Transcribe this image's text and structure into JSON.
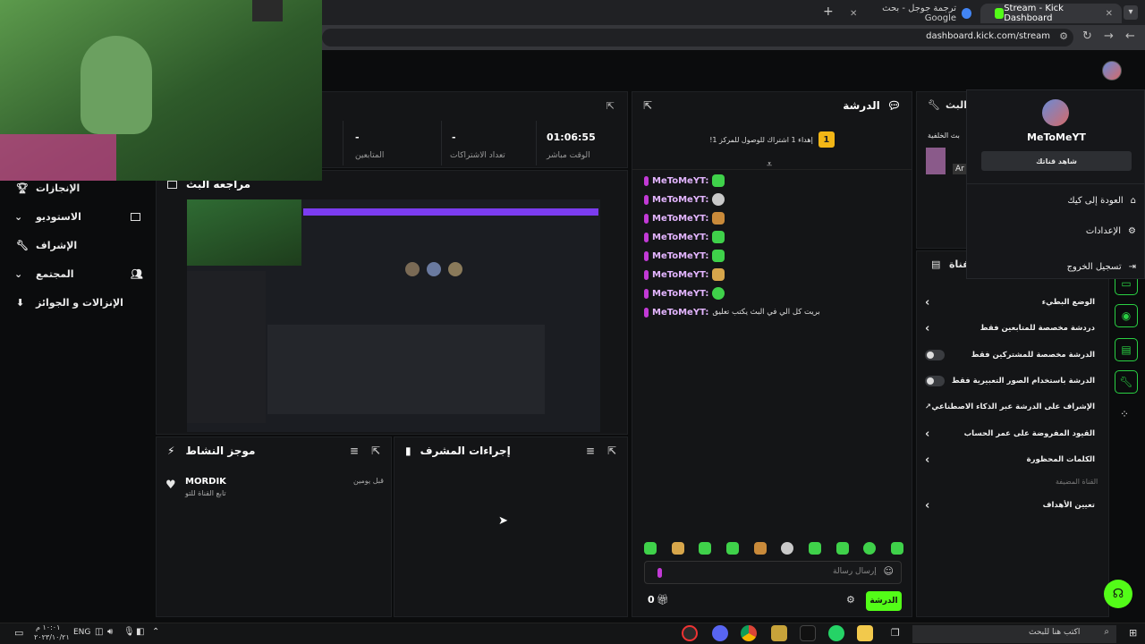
{
  "browser": {
    "tabs": [
      {
        "title": "Stream - Kick Dashboard",
        "active": true
      },
      {
        "title": "ترجمة جوجل - بحث Google",
        "active": false
      }
    ],
    "url": "dashboard.kick.com/stream"
  },
  "sidebar": {
    "items": [
      {
        "label": "الإنجازات"
      },
      {
        "label": "الاستوديو"
      },
      {
        "label": "الإشراف"
      },
      {
        "label": "المجتمع"
      },
      {
        "label": "الإنزالات و الجوائز"
      }
    ]
  },
  "stats": {
    "live_time_label": "الوقت مباشر",
    "live_time_value": "01:06:55",
    "subs_label": "تعداد الاشتراكات",
    "subs_value": "-",
    "followers_label": "المتابعين",
    "followers_value": "-"
  },
  "preview": {
    "title": "مراجعه البث"
  },
  "activity": {
    "title": "موجز النشاط",
    "items": [
      {
        "user": "MORDIK",
        "action": "تابع القناة للتو",
        "time": "قبل يومين"
      }
    ]
  },
  "mod_actions": {
    "title": "إجراءات المشرف"
  },
  "chat": {
    "title": "الدرشة",
    "goal_text": "إهداء 1 اشتراك للوصول للمركز 1!",
    "goal_rank": "1",
    "messages": [
      {
        "user": "MeToMeYT:",
        "text": ""
      },
      {
        "user": "MeToMeYT:",
        "text": ""
      },
      {
        "user": "MeToMeYT:",
        "text": ""
      },
      {
        "user": "MeToMeYT:",
        "text": ""
      },
      {
        "user": "MeToMeYT:",
        "text": ""
      },
      {
        "user": "MeToMeYT:",
        "text": ""
      },
      {
        "user": "MeToMeYT:",
        "text": ""
      },
      {
        "user": "MeToMeYT:",
        "text": "بريت كل الي في البث يكتب تعليق"
      }
    ],
    "input_placeholder": "إرسال رسالة",
    "send_label": "الدرشة",
    "points": "0"
  },
  "stream_info": {
    "title": "البث",
    "partial_text": "بث الخلفية",
    "tag": "Ar"
  },
  "channel": {
    "title": "القناة",
    "settings": [
      {
        "label": "الوضع البطيء",
        "control": "chevron"
      },
      {
        "label": "دردشة مخصصة للمتابعين فقط",
        "control": "chevron"
      },
      {
        "label": "الدرشة مخصصة للمشتركين فقط",
        "control": "toggle"
      },
      {
        "label": "الدرشة باستخدام الصور التعبيرية فقط",
        "control": "toggle"
      },
      {
        "label": "الإشراف على الدرشة عبر الذكاء الاصطناعي",
        "control": "external"
      },
      {
        "label": "القيود المفروضة على عمر الحساب",
        "control": "chevron"
      },
      {
        "label": "الكلمات المحظورة",
        "control": "chevron"
      }
    ],
    "section_label": "القناة المضيفة",
    "host_setting": "تعيين الأهداف"
  },
  "profile_menu": {
    "username": "MeToMeYT",
    "watch_channel": "شاهد قناتك",
    "items": [
      {
        "label": "العودة إلى كيك",
        "icon": "home-icon"
      },
      {
        "label": "الإعدادات",
        "icon": "gear-icon"
      },
      {
        "label": "تسجيل الخروج",
        "icon": "logout-icon"
      }
    ]
  },
  "taskbar": {
    "search_placeholder": "اكتب هنا للبحث",
    "lang": "ENG",
    "time": "١٠:٠١ م",
    "date": "٢٠٢٣/١٠/٢١"
  },
  "colors": {
    "accent": "#53fc18",
    "bg": "#0b0c0d",
    "panel": "#141517"
  }
}
